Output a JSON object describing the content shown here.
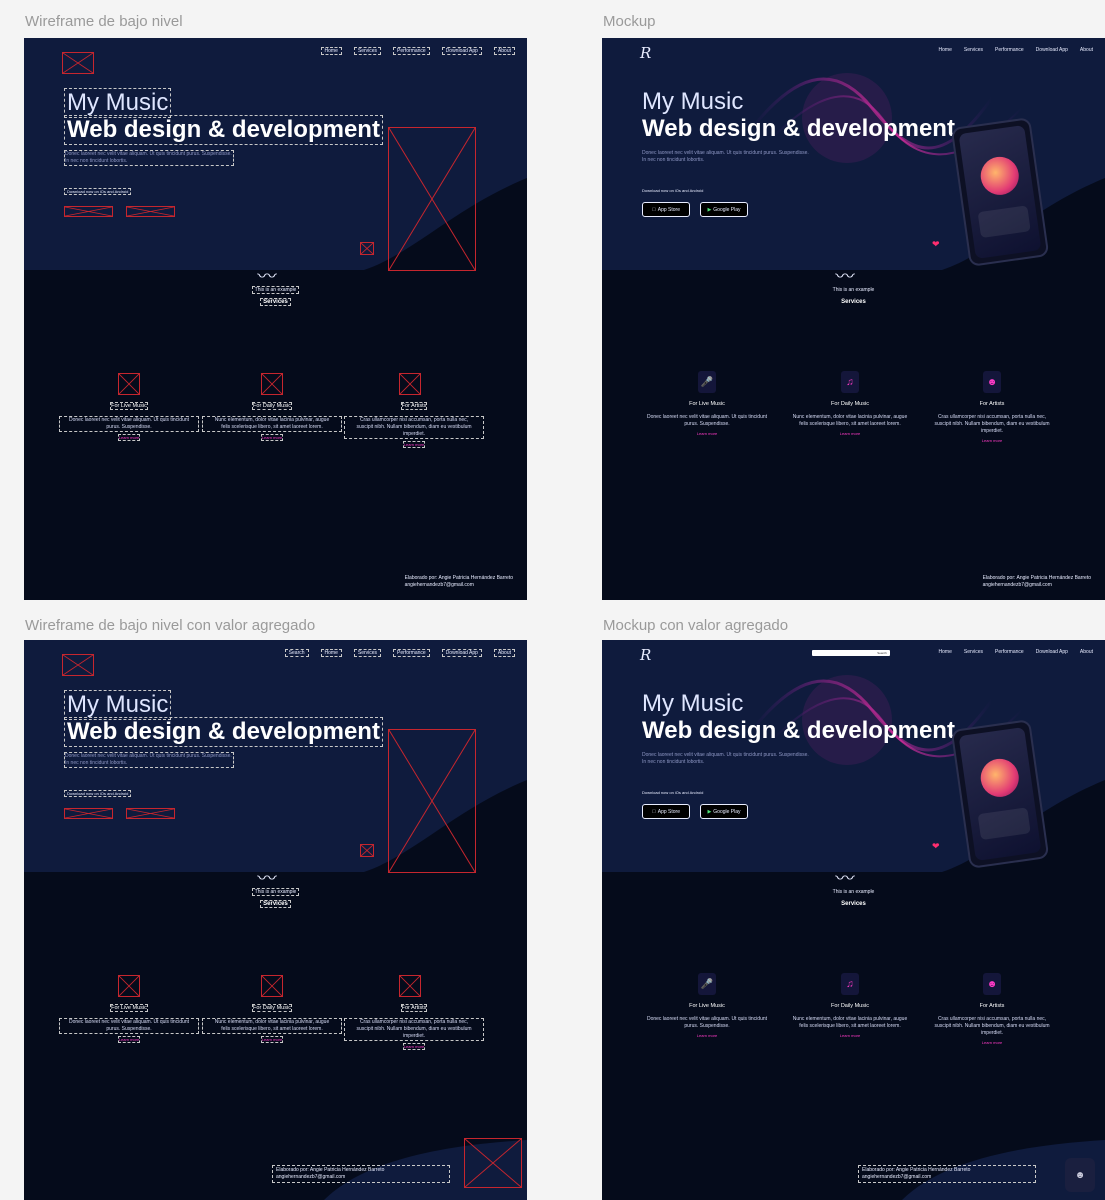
{
  "labels": {
    "wf1": "Wireframe de bajo nivel",
    "mk1": "Mockup",
    "wf2": "Wireframe de bajo nivel con valor agregado",
    "mk2": "Mockup con valor agregado"
  },
  "nav": [
    "Home",
    "Services",
    "Performance",
    "Download App",
    "About"
  ],
  "search": {
    "button": "Search"
  },
  "hero": {
    "title_small": "My Music",
    "title_big": "Web design & development",
    "subtitle": "Donec laoreet nec velit vitae aliquam. Ut quis tincidunt purus. Suspendisse. In nec non tincidunt lobortis.",
    "download_label": "Download now on iOs and Android",
    "app_store": "App Store",
    "google_play": "Google Play"
  },
  "services": {
    "example": "This is an example",
    "heading": "Services",
    "items": [
      {
        "title": "For Live Music",
        "desc": "Donec laoreet nec velit vitae aliquam. Ut quis tincidunt purus. Suspendisse.",
        "link": "Learn more",
        "icon": "microphone-icon"
      },
      {
        "title": "For Daily Music",
        "desc": "Nunc elementum, dolor vitae lacinia pulvinar, augue felis scelerisque libero, sit amet laoreet lorem.",
        "link": "Learn more",
        "icon": "music-note-icon"
      },
      {
        "title": "For Artists",
        "desc": "Cras ullamcorper nisi accumsan, porta nulla nec, suscipit nibh. Nullam bibendum, diam eu vestibulum imperdiet.",
        "link": "Learn more",
        "icon": "artist-icon"
      }
    ]
  },
  "credits": {
    "line1": "Elaborado por: Angie Patricia Hernández Barreto",
    "line2": "angiehernandezb7@gmail.com"
  },
  "colors": {
    "accent": "#ff3ac6",
    "bg": "#050b1b",
    "hero": "#0f1b3d",
    "wire": "#c6262e"
  }
}
